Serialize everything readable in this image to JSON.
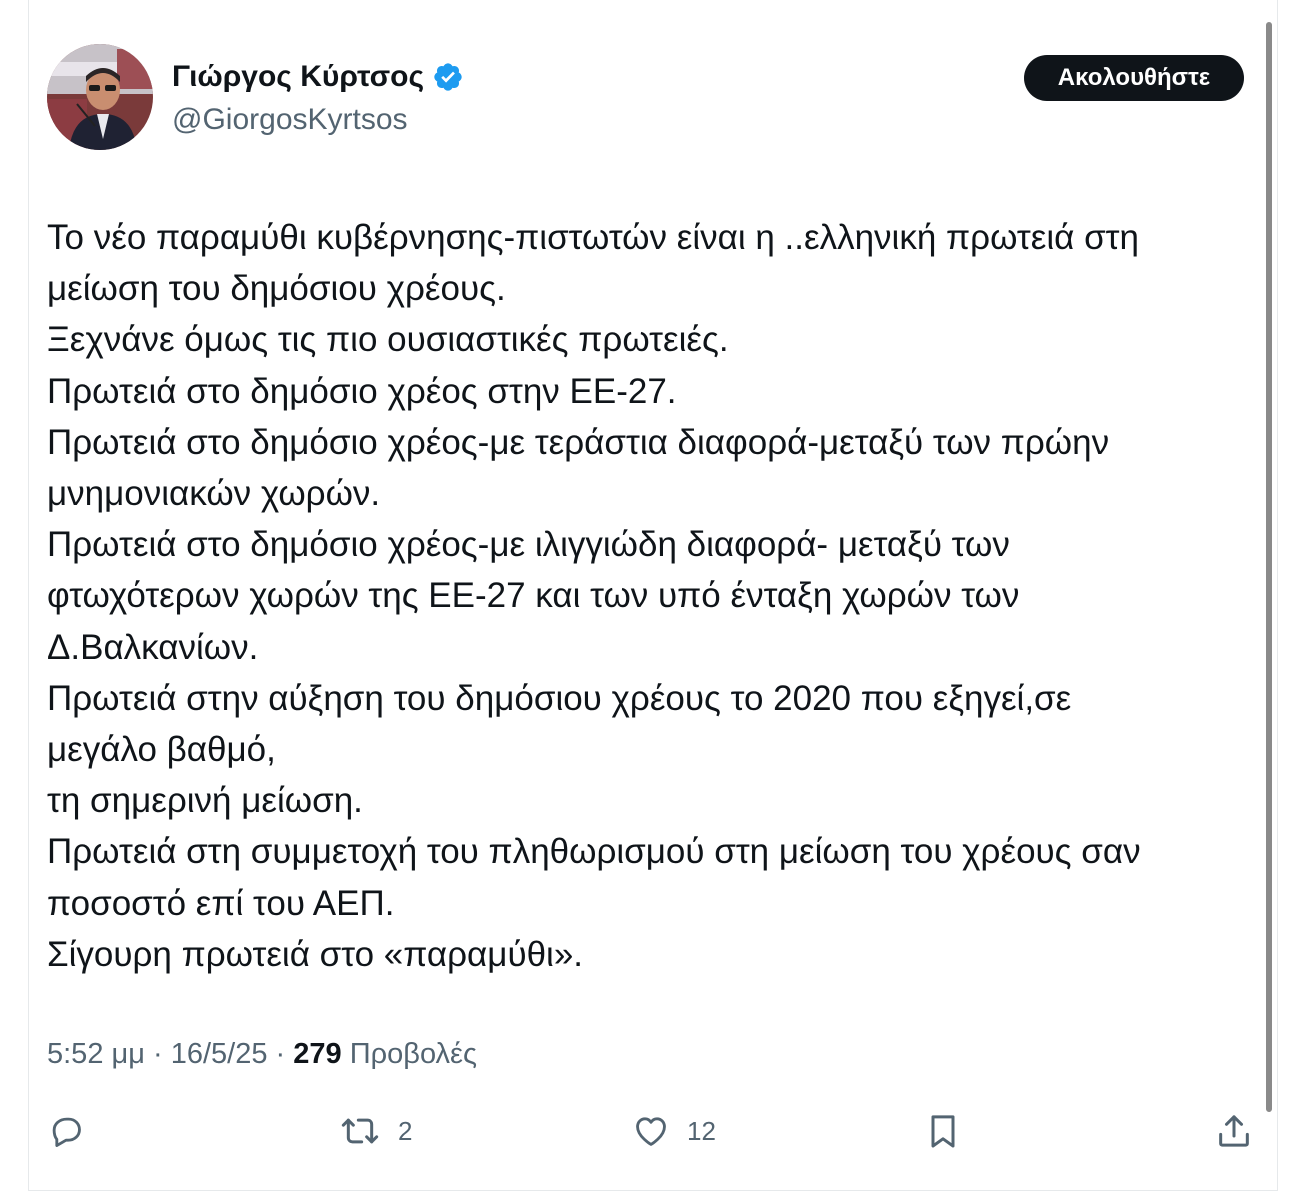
{
  "user": {
    "display_name": "Γιώργος Κύρτσος",
    "handle": "@GiorgosKyrtsos",
    "verified": true
  },
  "follow_button_label": "Ακολουθήστε",
  "tweet": {
    "lines": [
      "Το νέο παραμύθι κυβέρνησης-πιστωτών είναι η ..ελληνική πρωτειά στη",
      "μείωση του δημόσιου χρέους.",
      "Ξεχνάνε όμως τις πιο ουσιαστικές πρωτειές.",
      "Πρωτειά στο δημόσιο χρέος στην ΕΕ-27.",
      "Πρωτειά στο δημόσιο χρέος-με τεράστια διαφορά-μεταξύ των πρώην",
      "μνημονιακών χωρών.",
      "Πρωτειά στο δημόσιο χρέος-με ιλιγγιώδη διαφορά- μεταξύ των",
      "φτωχότερων χωρών της ΕΕ-27 και των υπό ένταξη χωρών των",
      "Δ.Βαλκανίων.",
      "Πρωτειά στην αύξηση του δημόσιου χρέους το 2020 που εξηγεί,σε",
      "μεγάλο βαθμό,",
      "τη σημερινή μείωση.",
      "Πρωτειά στη συμμετοχή του πληθωρισμού στη μείωση του χρέους σαν",
      "ποσοστό επί του ΑΕΠ.",
      "Σίγουρη πρωτειά στο «παραμύθι»."
    ]
  },
  "meta": {
    "time": "5:52 μμ",
    "separator": " · ",
    "date": "16/5/25",
    "views_count": "279",
    "views_label": "Προβολές"
  },
  "actions": {
    "reply": {
      "icon": "reply-icon",
      "count": ""
    },
    "retweet": {
      "icon": "retweet-icon",
      "count": "2"
    },
    "like": {
      "icon": "heart-icon",
      "count": "12"
    },
    "bookmark": {
      "icon": "bookmark-icon",
      "count": ""
    },
    "share": {
      "icon": "share-icon",
      "count": ""
    }
  },
  "colors": {
    "text_primary": "#0f1419",
    "text_secondary": "#536471",
    "verified_badge": "#1d9bf0",
    "follow_button_bg": "#0f1419",
    "border": "#e6e9eb"
  }
}
